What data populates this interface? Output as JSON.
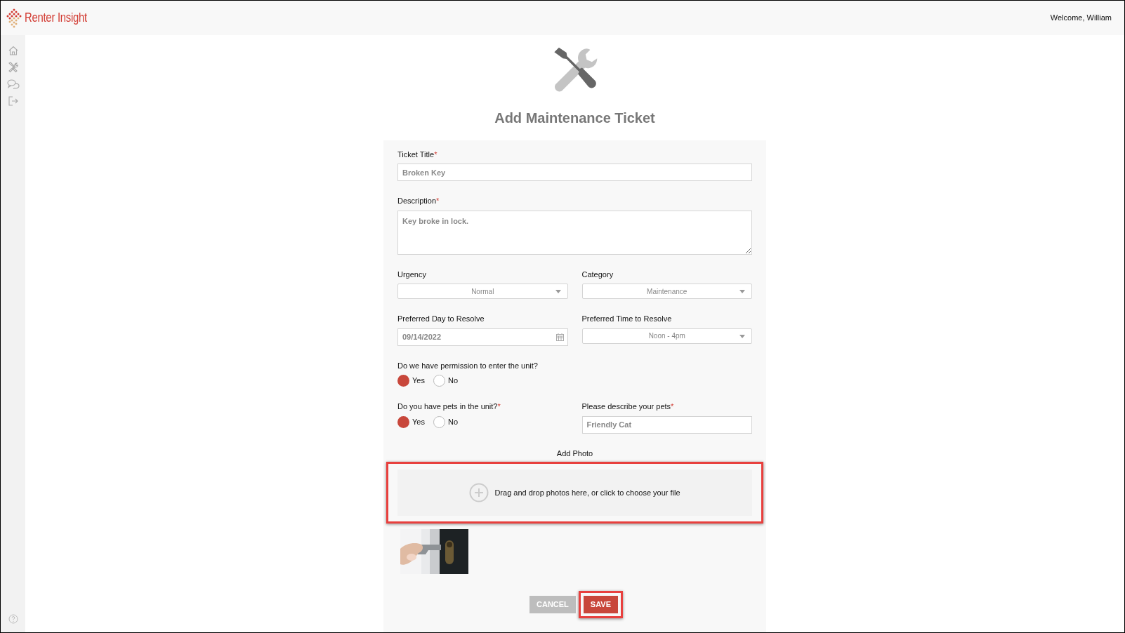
{
  "header": {
    "brand": "Renter Insight",
    "welcome": "Welcome, William"
  },
  "form": {
    "title": "Add Maintenance Ticket",
    "rows": [
      {
        "fields": [
          {
            "kind": "text",
            "label": "Ticket Title",
            "required_mark": "*",
            "value": "Broken Key"
          }
        ]
      },
      {
        "fields": [
          {
            "kind": "textarea",
            "label": "Description",
            "required_mark": "*",
            "value": "Key broke in lock."
          }
        ]
      },
      {
        "fields": [
          {
            "kind": "select",
            "label": "Urgency",
            "value": "Normal"
          },
          {
            "kind": "select",
            "label": "Category",
            "value": "Maintenance"
          }
        ]
      },
      {
        "fields": [
          {
            "kind": "date",
            "label": "Preferred Day to Resolve",
            "value": "09/14/2022"
          },
          {
            "kind": "select",
            "label": "Preferred Time to Resolve",
            "value": "Noon - 4pm"
          }
        ]
      },
      {
        "fields": [
          {
            "kind": "radio",
            "label": "Do we have permission to enter the unit?",
            "options": [
              {
                "label": "Yes",
                "selected": true
              },
              {
                "label": "No",
                "selected": false
              }
            ]
          }
        ]
      },
      {
        "fields": [
          {
            "kind": "radio",
            "label": "Do you have pets in the unit?",
            "required_mark": "*",
            "options": [
              {
                "label": "Yes",
                "selected": true
              },
              {
                "label": "No",
                "selected": false
              }
            ]
          },
          {
            "kind": "text",
            "label": "Please describe your pets",
            "required_mark": "*",
            "value": "Friendly Cat"
          }
        ]
      }
    ],
    "photo": {
      "label": "Add Photo",
      "dropzone_text": "Drag and drop photos here, or click to choose your file",
      "highlighted": true
    },
    "buttons": [
      {
        "label": "CANCEL",
        "kind": "secondary",
        "highlighted": false
      },
      {
        "label": "SAVE",
        "kind": "primary",
        "highlighted": true
      }
    ]
  }
}
